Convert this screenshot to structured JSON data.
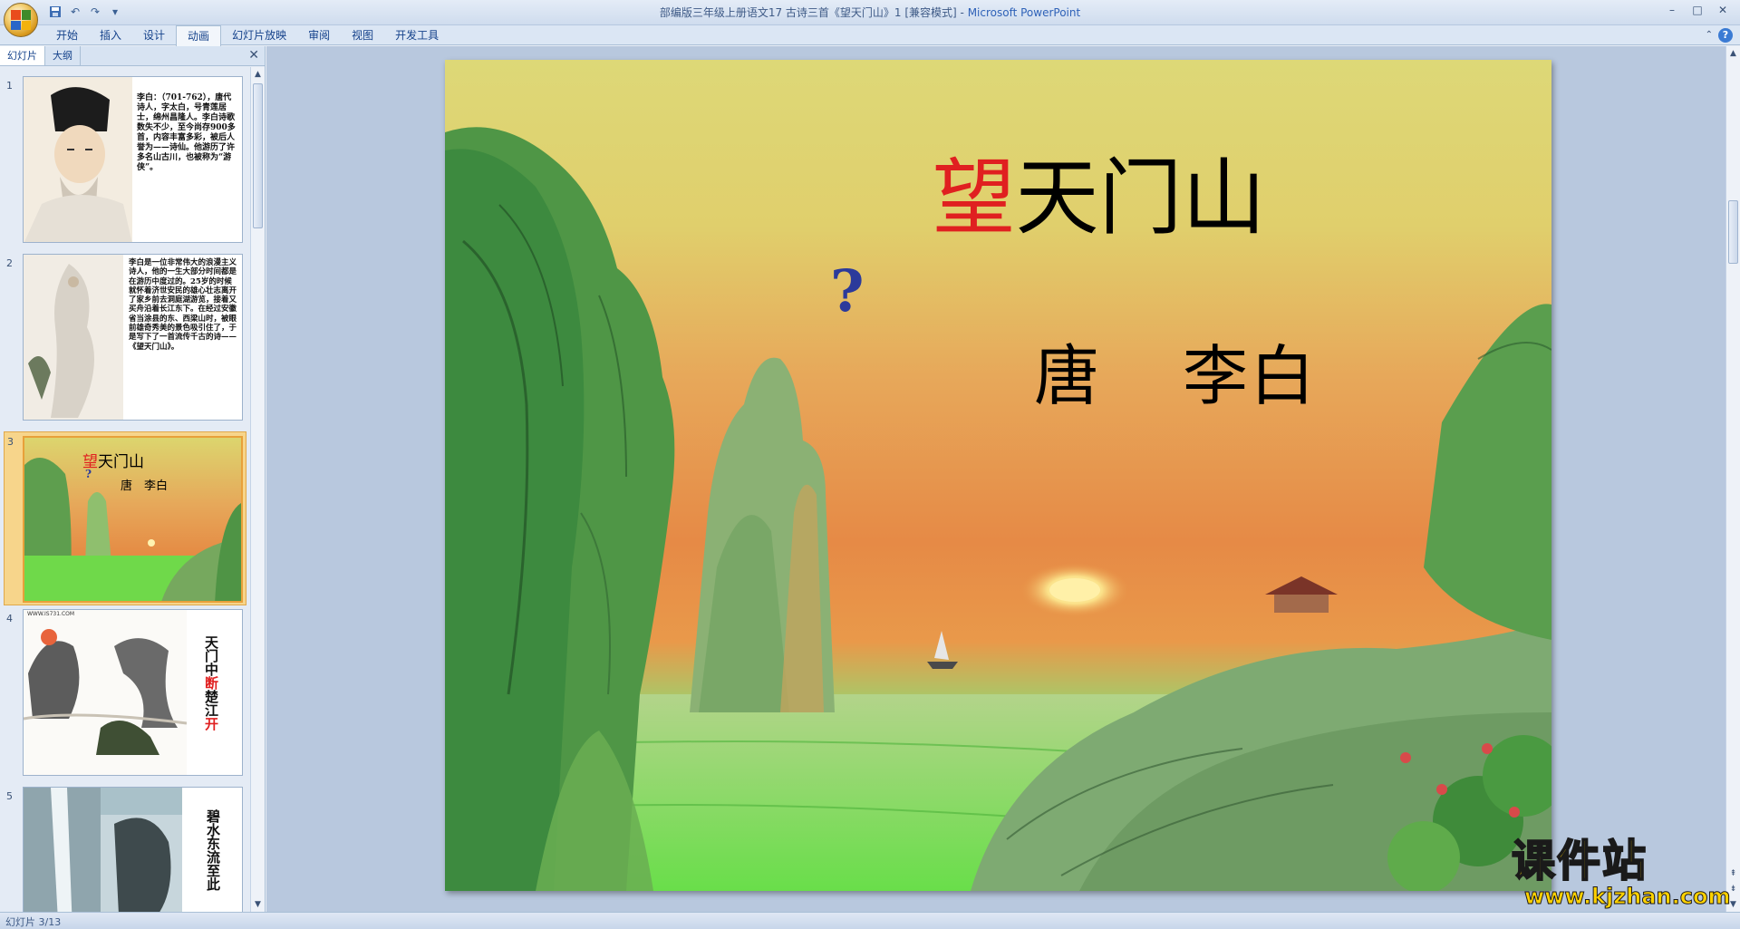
{
  "window": {
    "title": "部编版三年级上册语文17 古诗三首《望天门山》1 [兼容模式]",
    "title_separator": " - ",
    "app_name": "Microsoft PowerPoint",
    "controls": {
      "minimize": "–",
      "maximize": "□",
      "close": "✕"
    }
  },
  "quick_access": {
    "save": "save-icon",
    "undo": "undo-icon",
    "redo": "redo-icon",
    "customize": "▾"
  },
  "ribbon": {
    "tabs": [
      {
        "label": "开始"
      },
      {
        "label": "插入"
      },
      {
        "label": "设计"
      },
      {
        "label": "动画"
      },
      {
        "label": "幻灯片放映"
      },
      {
        "label": "审阅"
      },
      {
        "label": "视图"
      },
      {
        "label": "开发工具"
      }
    ],
    "active_tab": "动画",
    "help": "?"
  },
  "left_pane": {
    "tabs": [
      {
        "label": "幻灯片"
      },
      {
        "label": "大纲"
      }
    ],
    "active_tab": "幻灯片",
    "close": "✕",
    "slides": [
      {
        "number": "1",
        "text": "李白：（701-762），唐代诗人，字太白，号青莲居士，绵州昌隆人。李白诗歌数失不少，至今尚存900多首，内容丰富多彩，被后人誉为——诗仙。他游历了许多名山古川，也被称为“游侠”。"
      },
      {
        "number": "2",
        "text": "李白是一位非常伟大的浪漫主义诗人，他的一生大部分时间都是在游历中度过的。25岁的时候就怀着济世安民的雄心壮志离开了家乡前去洞庭湖游览，接着又买舟沿着长江东下。在经过安徽省当涂县的东、西梁山时，被眼前雄奇秀美的景色吸引住了，于是写下了一首流传千古的诗——《望天门山》。"
      },
      {
        "number": "3",
        "title_highlight": "望",
        "title_rest": "天门山",
        "qmark": "?",
        "author": "唐　李白"
      },
      {
        "number": "4",
        "source": "WWW.IS731.COM",
        "line_black": "天门中",
        "char_red": "断",
        "char_black": "楚江",
        "char_red2": "开"
      },
      {
        "number": "5",
        "text": "碧水东流至此"
      }
    ]
  },
  "slide": {
    "title_highlight": "望",
    "title_rest": "天门山",
    "question_mark": "?",
    "dynasty": "唐",
    "author": "李白"
  },
  "watermark": {
    "text": "课件站",
    "url": "www.kjzhan.com"
  },
  "status_bar": {
    "slide_info": "幻灯片 3/13"
  },
  "colors": {
    "highlight_red": "#e02020",
    "question_blue": "#2b3a9b",
    "selection": "#f7d58b",
    "ribbon": "#dbe6f4"
  }
}
